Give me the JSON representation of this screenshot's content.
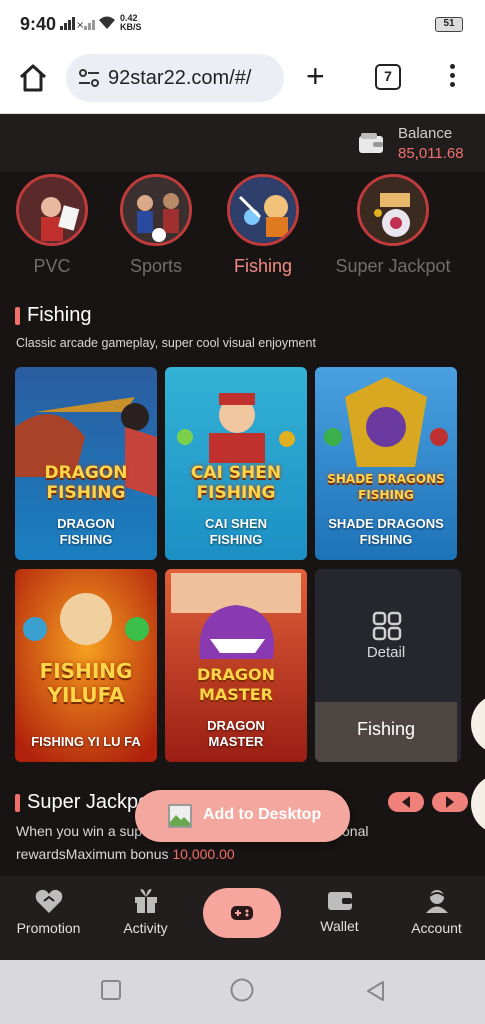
{
  "status_bar": {
    "time": "9:40",
    "speed": "0.42",
    "speed_unit": "KB/S",
    "battery": "51"
  },
  "browser": {
    "url": "92star22.com/#/",
    "tab_count": "7"
  },
  "balance": {
    "label": "Balance",
    "value": "85,011.68"
  },
  "categories": [
    {
      "label": "PVC",
      "active": false
    },
    {
      "label": "Sports",
      "active": false
    },
    {
      "label": "Fishing",
      "active": true
    },
    {
      "label": "Super Jackpot",
      "active": false
    }
  ],
  "fishing": {
    "title": "Fishing",
    "description": "Classic arcade gameplay, super cool visual enjoyment",
    "games": [
      {
        "name_line1": "DRAGON",
        "name_line2": "FISHING",
        "logo_line1": "DRAGON",
        "logo_line2": "FISHING"
      },
      {
        "name_line1": "CAI SHEN",
        "name_line2": "FISHING",
        "logo_line1": "CAI SHEN",
        "logo_line2": "FISHING"
      },
      {
        "name_line1": "SHADE DRAGONS",
        "name_line2": "FISHING",
        "logo_line1": "SHADE DRAGONS",
        "logo_line2": "FISHING"
      },
      {
        "name_line1": "FISHING YI LU FA",
        "name_line2": "",
        "logo_line1": "FISHING",
        "logo_line2": "YILUFA"
      },
      {
        "name_line1": "DRAGON",
        "name_line2": "MASTER",
        "logo_line1": "DRAGON",
        "logo_line2": "MASTER"
      }
    ],
    "detail_card": {
      "label": "Detail",
      "bottom_label": "Fishing"
    }
  },
  "super_jackpot": {
    "title": "Super Jackpo",
    "desc_part1": "When you win a sup",
    "desc_part2": "onal",
    "bonus_prefix": "rewardsMaximum bonus",
    "bonus_value": "10,000.00"
  },
  "add_to_desktop": "Add to Desktop",
  "bottom_nav": {
    "items": [
      {
        "label": "Promotion"
      },
      {
        "label": "Activity"
      },
      {
        "label": ""
      },
      {
        "label": "Wallet"
      },
      {
        "label": "Account"
      }
    ]
  },
  "colors": {
    "accent": "#f0706c",
    "background": "#191414",
    "center_button": "#f7a59d"
  }
}
